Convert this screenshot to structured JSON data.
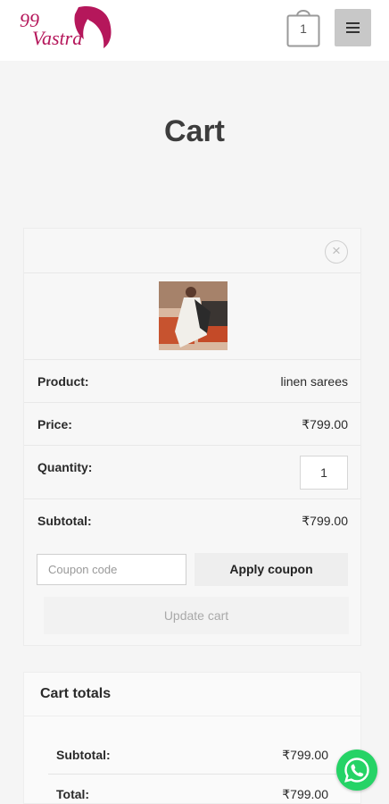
{
  "header": {
    "logo_number": "99",
    "logo_name": "Vastra",
    "cart_count": "1",
    "brand_color": "#b5175b"
  },
  "page": {
    "title": "Cart"
  },
  "cart_item": {
    "remove_symbol": "×",
    "product_label": "Product:",
    "product_name": "linen sarees",
    "price_label": "Price:",
    "price": "₹799.00",
    "quantity_label": "Quantity:",
    "quantity": "1",
    "subtotal_label": "Subtotal:",
    "subtotal": "₹799.00"
  },
  "coupon": {
    "placeholder": "Coupon code",
    "apply_label": "Apply coupon",
    "update_label": "Update cart"
  },
  "totals": {
    "title": "Cart totals",
    "subtotal_label": "Subtotal:",
    "subtotal": "₹799.00",
    "total_label": "Total:",
    "total": "₹799.00"
  },
  "icons": {
    "cart": "shopping-bag-icon",
    "menu": "hamburger-icon",
    "remove": "close-circle-icon",
    "chat": "whatsapp-icon"
  }
}
